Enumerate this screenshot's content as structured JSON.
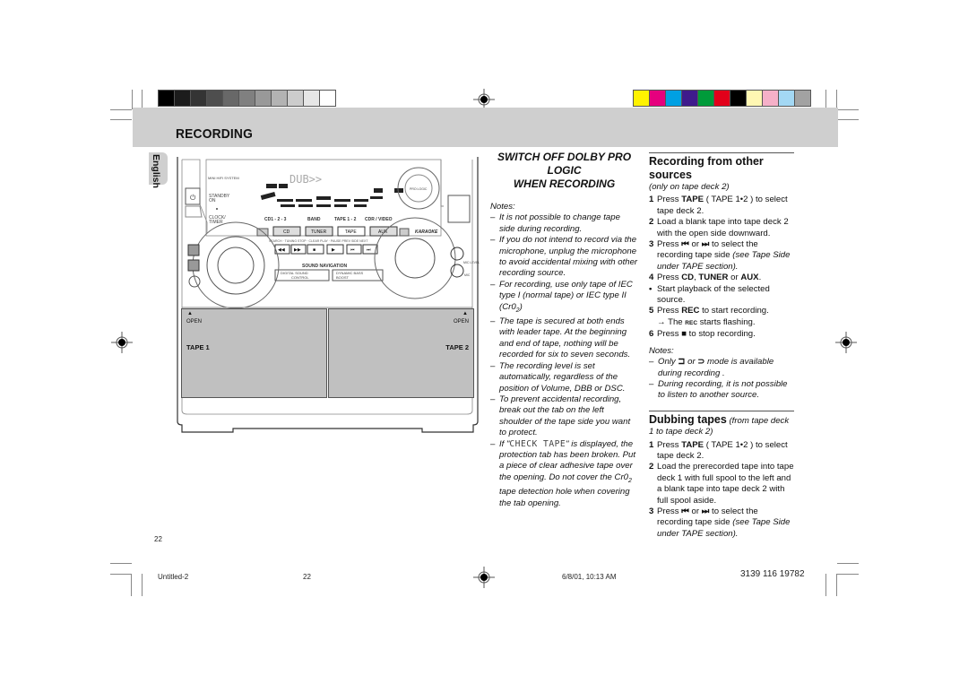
{
  "color_bars": {
    "gray": [
      "#000000",
      "#1c1c1c",
      "#343434",
      "#4e4e4e",
      "#686868",
      "#808080",
      "#999999",
      "#b3b3b3",
      "#cccccc",
      "#e6e6e6",
      "#ffffff"
    ],
    "color": [
      "#fff200",
      "#e6007e",
      "#00a0e3",
      "#3f1b8c",
      "#009b3a",
      "#e2001a",
      "#000000",
      "#fff7b3",
      "#f5b0c8",
      "#a3d8f4",
      "#a2a2a2"
    ]
  },
  "header": {
    "title": "RECORDING"
  },
  "language_tab": {
    "label": "English"
  },
  "device_illustration": {
    "model_label": "MINI HIFI SYSTEM",
    "standby_label": "STANDBY ON",
    "clock_label": "CLOCK/ TIMER",
    "source_labels": [
      "CD1 - 2 - 3",
      "BAND",
      "TAPE 1 - 2",
      "CDR / VIDEO"
    ],
    "source_buttons": [
      "CD",
      "TUNER",
      "TAPE",
      "AUX"
    ],
    "display_text": "DUB",
    "pro_logic_label": "PRO LOGIC",
    "karaoke_label": "KARAOKE",
    "sound_navigation_label": "SOUND NAVIGATION",
    "dsc_label": "DIGITAL SOUND CONTROL",
    "dbb_label": "DYNAMIC BASS BOOST",
    "mic_level_label": "MIC LEVEL",
    "mic_label": "MIC",
    "transport_labels": [
      "SEARCH · TUNING",
      "STOP · CLEAR",
      "PLAY · PAUSE",
      "PREV SIDE NEXT"
    ],
    "deck1": {
      "open_label": "OPEN",
      "name": "TAPE 1"
    },
    "deck2": {
      "open_label": "OPEN",
      "name": "TAPE 2"
    }
  },
  "middle_column": {
    "title_line1": "SWITCH OFF DOLBY PRO LOGIC",
    "title_line2": "WHEN RECORDING",
    "notes_heading": "Notes:",
    "notes": [
      "It is not possible to change tape side during recording.",
      "If you do not intend to record via the microphone, unplug the microphone to avoid accidental mixing with other recording source.",
      "For recording, use only tape of IEC type I (normal tape) or IEC type II (Cr0",
      "The tape is secured at both ends with leader tape. At the beginning and end of tape, nothing will be recorded for six to seven seconds.",
      "The recording level is set automatically, regardless of the position of Volume, DBB or DSC.",
      "To prevent accidental recording, break out the tab on the left shoulder of the tape side you want to protect."
    ],
    "note3_suffix": ")",
    "note3_sub": "2",
    "check_tape": {
      "prefix": "If \"",
      "display": "CHECK TAPE",
      "middle": "\" is displayed, the protection tab has been broken.  Put a piece of clear adhesive tape over the opening.  Do not cover the Cr0",
      "sub": "2",
      "suffix": " tape detection hole when covering the tab opening."
    }
  },
  "right_column": {
    "section1": {
      "heading": "Recording from other sources",
      "subheading": "(only on tape deck 2)",
      "steps": [
        {
          "num": "1",
          "pre": "Press ",
          "bold": "TAPE",
          "post": " ( TAPE 1•2 ) to select tape deck 2."
        },
        {
          "num": "2",
          "text": "Load a blank tape into tape deck 2 with the open side downward."
        },
        {
          "num": "3",
          "pre": "Press ",
          "icon1": "⏮",
          "mid": " or ",
          "icon2": "⏭",
          "post": " to select the recording tape side ",
          "ital": "(see Tape Side under TAPE section)."
        },
        {
          "num": "4",
          "pre": "Press ",
          "bold1": "CD",
          "sep": ", ",
          "bold2": "TUNER",
          "or": " or ",
          "bold3": "AUX",
          "post": "."
        },
        {
          "num": "•",
          "text": "Start playback of the selected source."
        },
        {
          "num": "5",
          "pre": "Press ",
          "bold": "REC",
          "post": " to start recording."
        },
        {
          "num": "",
          "arrow": "→",
          "pre": " The ",
          "small": "REC",
          "post": " starts flashing."
        },
        {
          "num": "6",
          "pre": "Press ",
          "icon": "■",
          "post": "  to stop recording."
        }
      ],
      "notes_heading": "Notes:",
      "notes": [
        {
          "pre": "Only ",
          "icon1": "⊐",
          "mid": " or ",
          "icon2": "⊃",
          "post": " mode is available during recording ."
        },
        {
          "text": "During recording, it is not possible to listen to another source."
        }
      ]
    },
    "section2": {
      "heading": "Dubbing tapes",
      "heading_note": " (from tape deck 1 to tape deck 2)",
      "steps": [
        {
          "num": "1",
          "pre": "Press ",
          "bold": "TAPE",
          "post": " ( TAPE 1•2 ) to select tape deck 2."
        },
        {
          "num": "2",
          "text": "Load the prerecorded tape into tape deck 1 with full spool to the left and a blank tape into tape deck 2 with full spool aside."
        },
        {
          "num": "3",
          "pre": "Press ",
          "icon1": "⏮",
          "mid": " or ",
          "icon2": "⏭",
          "post": " to select the recording tape side ",
          "ital": "(see Tape Side under TAPE section)."
        }
      ]
    }
  },
  "footer": {
    "page_number": "22",
    "file_name": "Untitled-2",
    "file_page": "22",
    "timestamp": "6/8/01, 10:13 AM",
    "doc_code": "3139 116 19782"
  }
}
